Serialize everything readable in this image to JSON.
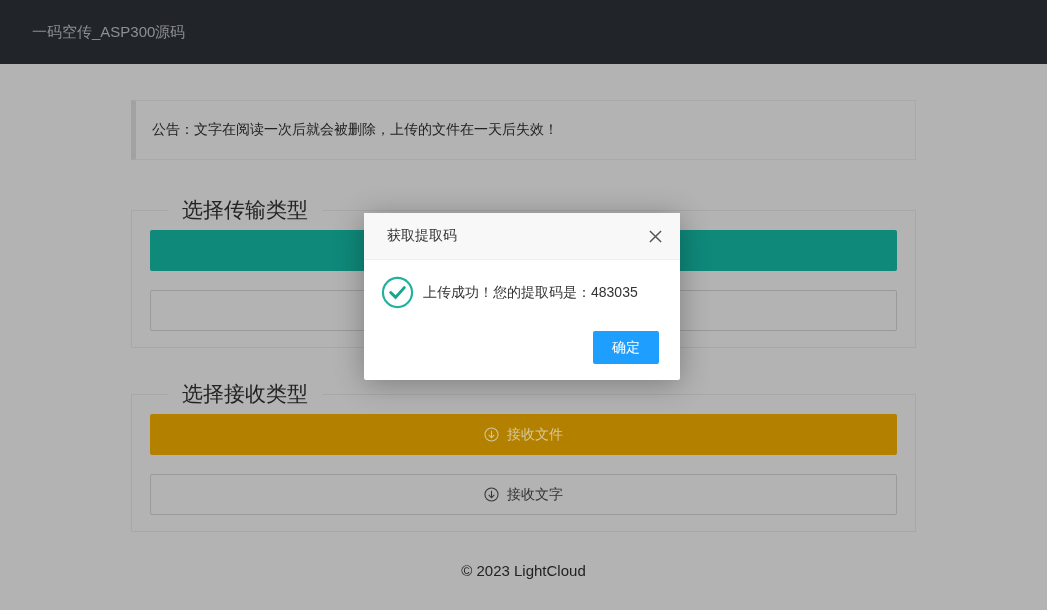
{
  "header": {
    "title": "一码空传_ASP300源码"
  },
  "notice": {
    "text": "公告：文字在阅读一次后就会被删除，上传的文件在一天后失效！"
  },
  "sections": [
    {
      "legend": "选择传输类型",
      "buttons": [
        {
          "kind": "primary"
        },
        {
          "kind": "outline"
        }
      ]
    },
    {
      "legend": "选择接收类型",
      "buttons": [
        {
          "kind": "warning",
          "label": "接收文件"
        },
        {
          "kind": "outline",
          "label": "接收文字"
        }
      ]
    }
  ],
  "footer": {
    "text": "© 2023 LightCloud"
  },
  "dialog": {
    "title": "获取提取码",
    "message": "上传成功！您的提取码是：483035",
    "button": "确定"
  }
}
